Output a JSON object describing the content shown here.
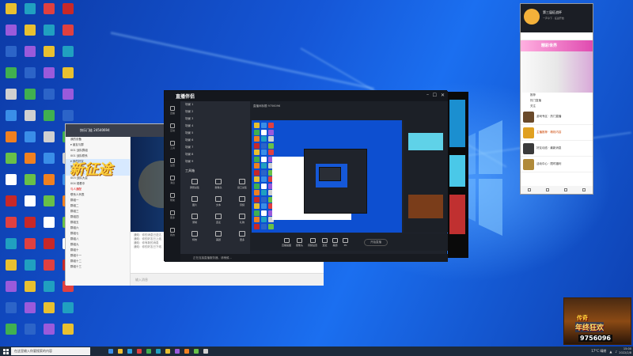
{
  "taskbar": {
    "search_placeholder": "在这里输入你要搜索的内容",
    "weather": "17°C 晴朗",
    "clock_time": "15:00",
    "clock_date": "2022/2/8"
  },
  "chat": {
    "title": "快乐门徒 24540694",
    "list": [
      {
        "text": "我的设备"
      },
      {
        "text": "▾ 朋友与群"
      },
      {
        "text": "  001 战队群组"
      },
      {
        "text": "  001 战队联系"
      },
      {
        "text": "▾ 我的好友",
        "sel": true
      },
      {
        "text": "  第一游戏室",
        "sel": true
      },
      {
        "text": "  第二游戏室",
        "sel": true
      },
      {
        "text": "  003 战队大会"
      },
      {
        "text": "  004 观看中"
      },
      {
        "text": "  与人通配",
        "red": true
      },
      {
        "text": "  联系人列表"
      },
      {
        "text": "  群组一"
      },
      {
        "text": "  群组二"
      },
      {
        "text": "  群组三"
      },
      {
        "text": "  群组四"
      },
      {
        "text": "  群组五"
      },
      {
        "text": "  群组六"
      },
      {
        "text": "  群组七"
      },
      {
        "text": "  群组八"
      },
      {
        "text": "  群组九"
      },
      {
        "text": "  群组十"
      },
      {
        "text": "  群组十一"
      },
      {
        "text": "  群组十二"
      },
      {
        "text": "  群组十三"
      }
    ],
    "banner_text": "新征途",
    "messages": [
      "通知：你的消息已送达",
      "通知：你的好友已上线",
      "通知：你有新的消息",
      "通知：你的好友已下线"
    ],
    "input_placeholder": "输入消息"
  },
  "app": {
    "logo": "直播伴侣",
    "sidebar": [
      "直播",
      "互动",
      "工具",
      "设置",
      "消息",
      "帮助",
      "更多",
      "我的"
    ],
    "scenes": [
      "场景 1",
      "场景 2",
      "场景 3",
      "场景 4",
      "场景 5",
      "场景 6",
      "场景 7",
      "场景 8",
      "场景 9"
    ],
    "tools_title": "工具箱",
    "tools": [
      "屏幕采集",
      "摄像头",
      "窗口采集",
      "图片",
      "文本",
      "音频",
      "录制",
      "连麦",
      "礼物",
      "特效",
      "美颜",
      "更多"
    ],
    "preview_title": "直播间标题 9756096",
    "bottom_buttons": [
      "直播画面",
      "摄像头",
      "音频设置",
      "连麦",
      "美颜",
      "PK"
    ],
    "go_live": "开始直播",
    "status": "正在连接直播服务器，请稍候..."
  },
  "panel": {
    "name": "第三届征战杯",
    "sub": "一声令下 · 征战开始",
    "ad": "精彩世界",
    "section_rows": [
      "推荐",
      "热门直播",
      "关注"
    ],
    "items": [
      {
        "text": "游戏专区 · 热门直播",
        "color": "#333"
      },
      {
        "text": "主播推荐 · 精彩内容",
        "color": "#c40"
      },
      {
        "text": "好友动态 · 最新消息",
        "color": "#333"
      },
      {
        "text": "活动中心 · 限时福利",
        "color": "#333"
      }
    ]
  },
  "promo": {
    "line1": "传奇",
    "line2": "年终狂欢",
    "number": "9756096"
  }
}
